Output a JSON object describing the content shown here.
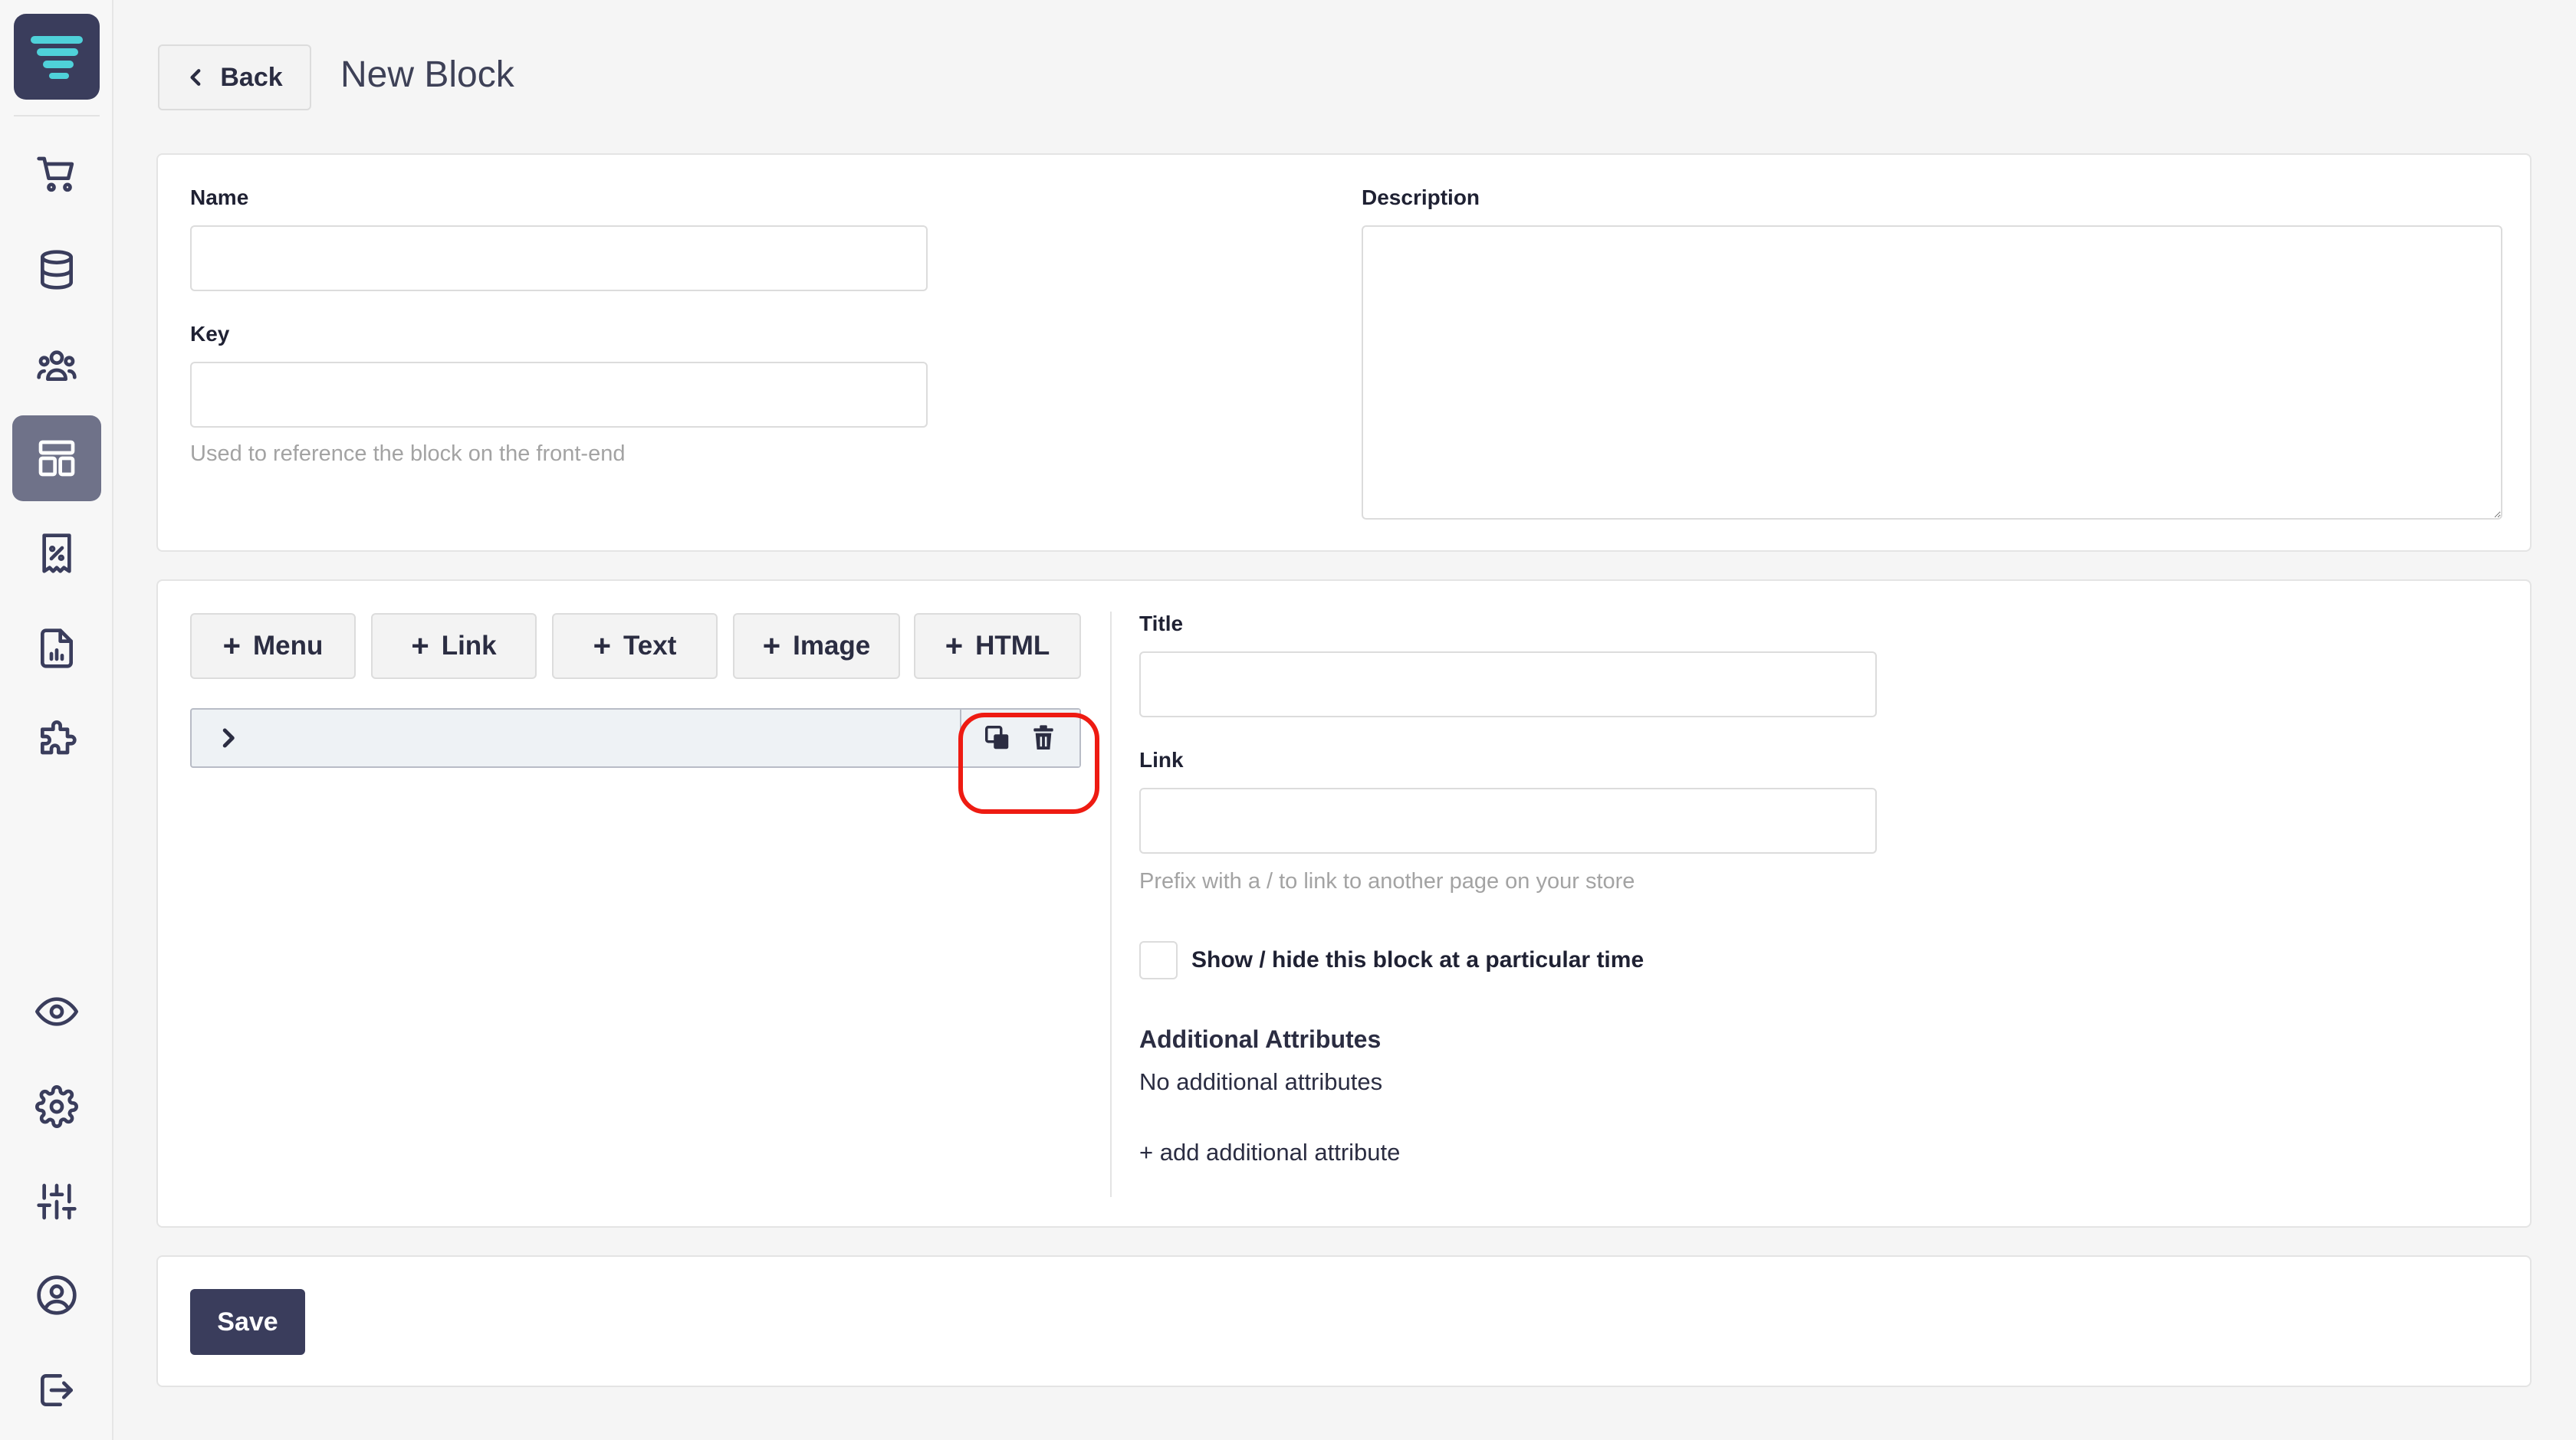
{
  "header": {
    "back_label": "Back",
    "title": "New Block"
  },
  "sidebar": {
    "items": [
      {
        "icon": "cart-icon"
      },
      {
        "icon": "database-icon"
      },
      {
        "icon": "users-icon"
      },
      {
        "icon": "layout-icon",
        "active": true
      },
      {
        "icon": "discount-icon"
      },
      {
        "icon": "report-icon"
      },
      {
        "icon": "puzzle-icon"
      },
      {
        "icon": "eye-icon"
      },
      {
        "icon": "gear-icon"
      },
      {
        "icon": "sliders-icon"
      },
      {
        "icon": "user-circle-icon"
      },
      {
        "icon": "logout-icon"
      }
    ]
  },
  "details": {
    "name_label": "Name",
    "name_value": "",
    "key_label": "Key",
    "key_value": "",
    "key_help": "Used to reference the block on the front-end",
    "description_label": "Description",
    "description_value": ""
  },
  "builder": {
    "add_buttons": [
      "Menu",
      "Link",
      "Text",
      "Image",
      "HTML"
    ]
  },
  "item_editor": {
    "title_label": "Title",
    "title_value": "",
    "link_label": "Link",
    "link_value": "",
    "link_help": "Prefix with a / to link to another page on your store",
    "schedule_label": "Show / hide this block at a particular time",
    "attributes_heading": "Additional Attributes",
    "attributes_empty": "No additional attributes",
    "add_attribute_label": "+ add additional attribute"
  },
  "footer": {
    "save_label": "Save"
  },
  "colors": {
    "brand": "#3a3d5c",
    "logo_accent": "#4fd1d9",
    "highlight": "#ee1b12"
  }
}
